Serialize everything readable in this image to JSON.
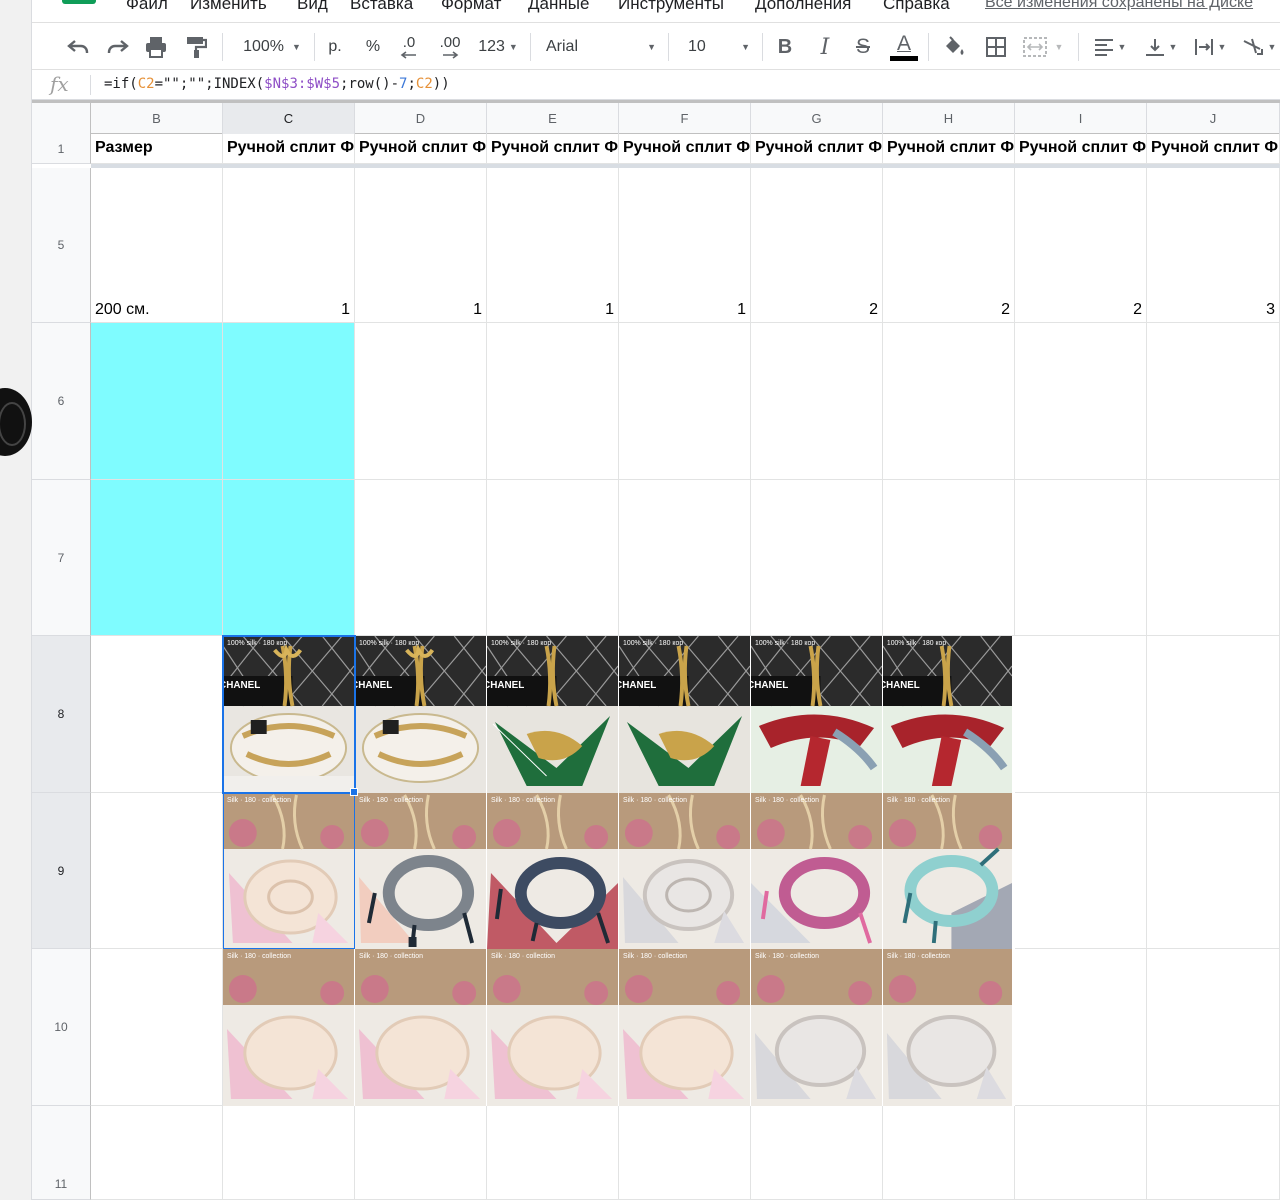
{
  "menu": {
    "items": [
      "Файл",
      "Изменить",
      "Вид",
      "Вставка",
      "Формат",
      "Данные",
      "Инструменты",
      "Дополнения",
      "Справка"
    ],
    "save_status": "Все изменения сохранены на Диске"
  },
  "toolbar": {
    "zoom": "100%",
    "currency": "р.",
    "percent": "%",
    "decimal_decrease": ".0",
    "decimal_increase": ".00",
    "more_formats": "123",
    "font": "Arial",
    "font_size": "10",
    "bold": "B",
    "italic": "I",
    "strike": "S",
    "text_color": "A"
  },
  "formula_bar": {
    "fx_label": "fx",
    "parts": [
      "=if(",
      "C2",
      "=\"\";\"\";INDEX(",
      "$N$3:$W$5",
      ";row()-",
      "7",
      ";",
      "C2",
      "))"
    ]
  },
  "columns": [
    "B",
    "C",
    "D",
    "E",
    "F",
    "G",
    "H",
    "I",
    "J"
  ],
  "rows": [
    "1",
    "5",
    "6",
    "7",
    "8",
    "9",
    "10",
    "11"
  ],
  "header_row": {
    "b": "Размер",
    "c": "Ручной сплит Ф",
    "d": "Ручной сплит Ф",
    "e": "Ручной сплит Ф",
    "f": "Ручной сплит Ф",
    "g": "Ручной сплит Ф",
    "h": "Ручной сплит Ф",
    "i": "Ручной сплит Ф",
    "j": "Ручной сплит Ф"
  },
  "row5": {
    "b": "200 см.",
    "values": [
      "1",
      "1",
      "1",
      "1",
      "2",
      "2",
      "2",
      "3"
    ]
  },
  "photos": {
    "row8_caption": "100% silk · 180 кор",
    "row9_caption": "Silk · 180 · collection",
    "row10_caption": "Silk · 180 · collection",
    "row8_brand": "CHANEL"
  },
  "colors": {
    "accent": "#1a73e8",
    "cyan_fill": "#7ffcff",
    "header_bg": "#f8f9fa",
    "sheets_green": "#0f9d58"
  }
}
